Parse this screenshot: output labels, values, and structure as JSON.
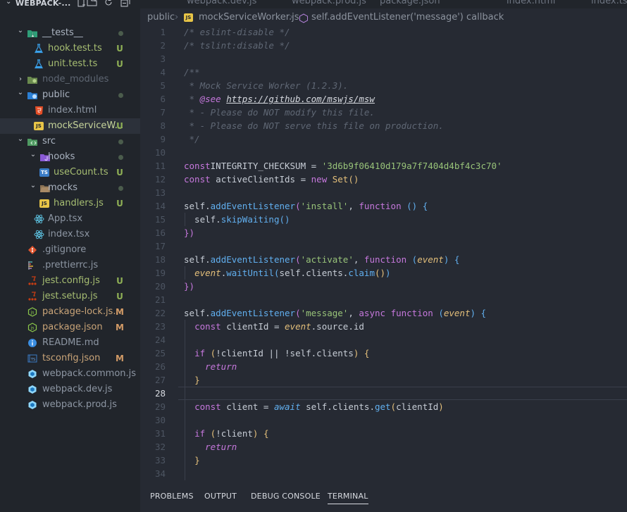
{
  "sidebar": {
    "title": "WEBPACK-...",
    "actions": [
      "new-file-icon",
      "new-folder-icon",
      "refresh-icon",
      "collapse-all-icon"
    ],
    "items": [
      {
        "label": "__tests__",
        "depth": 0,
        "kind": "folder",
        "open": true,
        "icon": "folder-tests-icon",
        "status": "dot"
      },
      {
        "label": "hook.test.ts",
        "depth": 1,
        "kind": "file",
        "icon": "test-flask-icon",
        "status": "U"
      },
      {
        "label": "unit.test.ts",
        "depth": 1,
        "kind": "file",
        "icon": "test-flask-icon",
        "status": "U"
      },
      {
        "label": "node_modules",
        "depth": 0,
        "kind": "folder",
        "open": false,
        "icon": "folder-node-icon",
        "dim": true
      },
      {
        "label": "public",
        "depth": 0,
        "kind": "folder",
        "open": true,
        "icon": "folder-public-icon",
        "status": "dot"
      },
      {
        "label": "index.html",
        "depth": 1,
        "kind": "file",
        "icon": "html-file-icon"
      },
      {
        "label": "mockServiceW...",
        "depth": 1,
        "kind": "file",
        "icon": "js-file-icon",
        "status": "U",
        "selected": true
      },
      {
        "label": "src",
        "depth": 0,
        "kind": "folder",
        "open": true,
        "icon": "folder-src-icon",
        "status": "dot"
      },
      {
        "label": "hooks",
        "depth": 1,
        "kind": "folder",
        "open": true,
        "icon": "folder-hooks-icon",
        "status": "dot"
      },
      {
        "label": "useCount.ts",
        "depth": 2,
        "kind": "file",
        "icon": "ts-file-icon",
        "status": "U"
      },
      {
        "label": "mocks",
        "depth": 1,
        "kind": "folder",
        "open": true,
        "icon": "folder-mocks-icon",
        "status": "dot"
      },
      {
        "label": "handlers.js",
        "depth": 2,
        "kind": "file",
        "icon": "js-file-icon",
        "status": "U"
      },
      {
        "label": "App.tsx",
        "depth": 1,
        "kind": "file",
        "icon": "react-icon"
      },
      {
        "label": "index.tsx",
        "depth": 1,
        "kind": "file",
        "icon": "react-icon"
      },
      {
        "label": ".gitignore",
        "depth": 0,
        "kind": "file",
        "icon": "git-icon"
      },
      {
        "label": ".prettierrc.js",
        "depth": 0,
        "kind": "file",
        "icon": "prettier-icon"
      },
      {
        "label": "jest.config.js",
        "depth": 0,
        "kind": "file",
        "icon": "jest-icon",
        "status": "U"
      },
      {
        "label": "jest.setup.js",
        "depth": 0,
        "kind": "file",
        "icon": "jest-icon",
        "status": "U"
      },
      {
        "label": "package-lock.js...",
        "depth": 0,
        "kind": "file",
        "icon": "nodejs-icon",
        "status": "M"
      },
      {
        "label": "package.json",
        "depth": 0,
        "kind": "file",
        "icon": "nodejs-icon",
        "status": "M"
      },
      {
        "label": "README.md",
        "depth": 0,
        "kind": "file",
        "icon": "info-icon"
      },
      {
        "label": "tsconfig.json",
        "depth": 0,
        "kind": "file",
        "icon": "tsconfig-icon",
        "status": "M"
      },
      {
        "label": "webpack.common.js",
        "depth": 0,
        "kind": "file",
        "icon": "webpack-icon"
      },
      {
        "label": "webpack.dev.js",
        "depth": 0,
        "kind": "file",
        "icon": "webpack-icon"
      },
      {
        "label": "webpack.prod.js",
        "depth": 0,
        "kind": "file",
        "icon": "webpack-icon"
      }
    ]
  },
  "tabs": [
    {
      "label": "webpack.dev.js"
    },
    {
      "label": "webpack.prod.js"
    },
    {
      "label": "package.json"
    },
    {
      "label": "index.html"
    },
    {
      "label": "index.ts"
    }
  ],
  "breadcrumb": {
    "folder": "public",
    "file": "mockServiceWorker.js",
    "symbol": "self.addEventListener('message') callback"
  },
  "editor": {
    "current_line": 28,
    "lines": [
      [
        [
          "c-com",
          "/* eslint-disable */"
        ]
      ],
      [
        [
          "c-com",
          "/* tslint:disable */"
        ]
      ],
      [],
      [
        [
          "c-com",
          "/**"
        ]
      ],
      [
        [
          "c-com",
          " * Mock Service Worker (1.2.3)."
        ]
      ],
      [
        [
          "c-com",
          " * "
        ],
        [
          "c-tag",
          "@see"
        ],
        [
          "c-com",
          " "
        ],
        [
          "c-url",
          "https://github.com/mswjs/msw"
        ]
      ],
      [
        [
          "c-com",
          " * - Please do NOT modify this file."
        ]
      ],
      [
        [
          "c-com",
          " * - Please do NOT serve this file on production."
        ]
      ],
      [
        [
          "c-com",
          " */"
        ]
      ],
      [],
      [
        [
          "c-kw",
          "const"
        ],
        [
          "",
          "INTEGRITY_CHECKSUM = "
        ],
        [
          "c-str",
          "'3d6b9f06410d179a7f7404d4bf4c3c70'"
        ]
      ],
      [
        [
          "c-kw",
          "const"
        ],
        [
          "",
          " activeClientIds = "
        ],
        [
          "c-kw",
          "new"
        ],
        [
          "",
          " "
        ],
        [
          "c-var",
          "Set"
        ],
        [
          "c-br1",
          "()"
        ]
      ],
      [],
      [
        [
          "",
          "self."
        ],
        [
          "c-fn",
          "addEventListener"
        ],
        [
          "c-br2",
          "("
        ],
        [
          "c-str",
          "'install'"
        ],
        [
          ", "
        ],
        [
          "c-kw",
          "function"
        ],
        [
          " "
        ],
        [
          "c-br3",
          "()"
        ],
        [
          " "
        ],
        [
          "c-br3",
          "{"
        ]
      ],
      [
        [
          "",
          "  self."
        ],
        [
          "c-fn",
          "skipWaiting"
        ],
        [
          "c-br3",
          "()"
        ]
      ],
      [
        [
          "c-br2",
          "})"
        ]
      ],
      [],
      [
        [
          "",
          "self."
        ],
        [
          "c-fn",
          "addEventListener"
        ],
        [
          "c-br2",
          "("
        ],
        [
          "c-str",
          "'activate'"
        ],
        [
          ", "
        ],
        [
          "c-kw",
          "function"
        ],
        [
          " "
        ],
        [
          "c-br3",
          "("
        ],
        [
          "c-par",
          "event"
        ],
        [
          "c-br3",
          ")"
        ],
        [
          " "
        ],
        [
          "c-br3",
          "{"
        ]
      ],
      [
        [
          "",
          "  "
        ],
        [
          "c-par",
          "event"
        ],
        [
          "",
          "."
        ],
        [
          "c-fn",
          "waitUntil"
        ],
        [
          "c-br3",
          "("
        ],
        [
          "",
          "self.clients."
        ],
        [
          "c-fn",
          "claim"
        ],
        [
          "c-br1",
          "()"
        ],
        [
          "c-br3",
          ")"
        ]
      ],
      [
        [
          "c-br2",
          "})"
        ]
      ],
      [],
      [
        [
          "",
          "self."
        ],
        [
          "c-fn",
          "addEventListener"
        ],
        [
          "c-br2",
          "("
        ],
        [
          "c-str",
          "'message'"
        ],
        [
          ", "
        ],
        [
          "c-kw",
          "async"
        ],
        [
          " "
        ],
        [
          "c-kw",
          "function"
        ],
        [
          " "
        ],
        [
          "c-br3",
          "("
        ],
        [
          "c-par",
          "event"
        ],
        [
          "c-br3",
          ")"
        ],
        [
          " "
        ],
        [
          "c-br3",
          "{"
        ]
      ],
      [
        [
          "",
          "  "
        ],
        [
          "c-kw",
          "const"
        ],
        [
          " clientId = "
        ],
        [
          "c-par",
          "event"
        ],
        [
          ".source.id"
        ]
      ],
      [],
      [
        [
          "",
          "  "
        ],
        [
          "c-kw",
          "if"
        ],
        [
          " "
        ],
        [
          "c-br1",
          "("
        ],
        [
          "",
          "!clientId || !self.clients"
        ],
        [
          "c-br1",
          ")"
        ],
        [
          " "
        ],
        [
          "c-br1",
          "{"
        ]
      ],
      [
        [
          "",
          "    "
        ],
        [
          "c-ret",
          "return"
        ]
      ],
      [
        [
          "",
          "  "
        ],
        [
          "c-br1",
          "}"
        ]
      ],
      [],
      [
        [
          "",
          "  "
        ],
        [
          "c-kw",
          "const"
        ],
        [
          " client = "
        ],
        [
          "c-aw",
          "await"
        ],
        [
          " self.clients."
        ],
        [
          "c-fn",
          "get"
        ],
        [
          "c-br1",
          "("
        ],
        [
          "",
          "clientId"
        ],
        [
          "c-br1",
          ")"
        ]
      ],
      [],
      [
        [
          "",
          "  "
        ],
        [
          "c-kw",
          "if"
        ],
        [
          " "
        ],
        [
          "c-br1",
          "("
        ],
        [
          "",
          "!client"
        ],
        [
          "c-br1",
          ")"
        ],
        [
          " "
        ],
        [
          "c-br1",
          "{"
        ]
      ],
      [
        [
          "",
          "    "
        ],
        [
          "c-ret",
          "return"
        ]
      ],
      [
        [
          "",
          "  "
        ],
        [
          "c-br1",
          "}"
        ]
      ],
      []
    ]
  },
  "panel": {
    "tabs": [
      {
        "label": "PROBLEMS"
      },
      {
        "label": "OUTPUT"
      },
      {
        "label": "DEBUG CONSOLE"
      },
      {
        "label": "TERMINAL",
        "active": true
      }
    ]
  },
  "colors": {
    "untracked": "#8fb055",
    "modified": "#d19a66",
    "folder_dot": "#4b5c4c"
  }
}
